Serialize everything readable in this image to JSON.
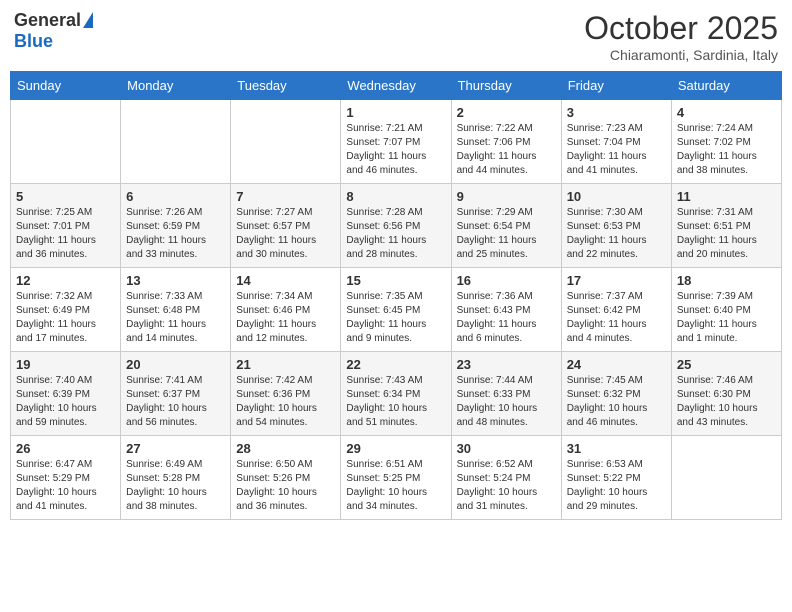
{
  "header": {
    "logo_general": "General",
    "logo_blue": "Blue",
    "month_title": "October 2025",
    "subtitle": "Chiaramonti, Sardinia, Italy"
  },
  "weekdays": [
    "Sunday",
    "Monday",
    "Tuesday",
    "Wednesday",
    "Thursday",
    "Friday",
    "Saturday"
  ],
  "weeks": [
    [
      {
        "day": "",
        "info": ""
      },
      {
        "day": "",
        "info": ""
      },
      {
        "day": "",
        "info": ""
      },
      {
        "day": "1",
        "info": "Sunrise: 7:21 AM\nSunset: 7:07 PM\nDaylight: 11 hours and 46 minutes."
      },
      {
        "day": "2",
        "info": "Sunrise: 7:22 AM\nSunset: 7:06 PM\nDaylight: 11 hours and 44 minutes."
      },
      {
        "day": "3",
        "info": "Sunrise: 7:23 AM\nSunset: 7:04 PM\nDaylight: 11 hours and 41 minutes."
      },
      {
        "day": "4",
        "info": "Sunrise: 7:24 AM\nSunset: 7:02 PM\nDaylight: 11 hours and 38 minutes."
      }
    ],
    [
      {
        "day": "5",
        "info": "Sunrise: 7:25 AM\nSunset: 7:01 PM\nDaylight: 11 hours and 36 minutes."
      },
      {
        "day": "6",
        "info": "Sunrise: 7:26 AM\nSunset: 6:59 PM\nDaylight: 11 hours and 33 minutes."
      },
      {
        "day": "7",
        "info": "Sunrise: 7:27 AM\nSunset: 6:57 PM\nDaylight: 11 hours and 30 minutes."
      },
      {
        "day": "8",
        "info": "Sunrise: 7:28 AM\nSunset: 6:56 PM\nDaylight: 11 hours and 28 minutes."
      },
      {
        "day": "9",
        "info": "Sunrise: 7:29 AM\nSunset: 6:54 PM\nDaylight: 11 hours and 25 minutes."
      },
      {
        "day": "10",
        "info": "Sunrise: 7:30 AM\nSunset: 6:53 PM\nDaylight: 11 hours and 22 minutes."
      },
      {
        "day": "11",
        "info": "Sunrise: 7:31 AM\nSunset: 6:51 PM\nDaylight: 11 hours and 20 minutes."
      }
    ],
    [
      {
        "day": "12",
        "info": "Sunrise: 7:32 AM\nSunset: 6:49 PM\nDaylight: 11 hours and 17 minutes."
      },
      {
        "day": "13",
        "info": "Sunrise: 7:33 AM\nSunset: 6:48 PM\nDaylight: 11 hours and 14 minutes."
      },
      {
        "day": "14",
        "info": "Sunrise: 7:34 AM\nSunset: 6:46 PM\nDaylight: 11 hours and 12 minutes."
      },
      {
        "day": "15",
        "info": "Sunrise: 7:35 AM\nSunset: 6:45 PM\nDaylight: 11 hours and 9 minutes."
      },
      {
        "day": "16",
        "info": "Sunrise: 7:36 AM\nSunset: 6:43 PM\nDaylight: 11 hours and 6 minutes."
      },
      {
        "day": "17",
        "info": "Sunrise: 7:37 AM\nSunset: 6:42 PM\nDaylight: 11 hours and 4 minutes."
      },
      {
        "day": "18",
        "info": "Sunrise: 7:39 AM\nSunset: 6:40 PM\nDaylight: 11 hours and 1 minute."
      }
    ],
    [
      {
        "day": "19",
        "info": "Sunrise: 7:40 AM\nSunset: 6:39 PM\nDaylight: 10 hours and 59 minutes."
      },
      {
        "day": "20",
        "info": "Sunrise: 7:41 AM\nSunset: 6:37 PM\nDaylight: 10 hours and 56 minutes."
      },
      {
        "day": "21",
        "info": "Sunrise: 7:42 AM\nSunset: 6:36 PM\nDaylight: 10 hours and 54 minutes."
      },
      {
        "day": "22",
        "info": "Sunrise: 7:43 AM\nSunset: 6:34 PM\nDaylight: 10 hours and 51 minutes."
      },
      {
        "day": "23",
        "info": "Sunrise: 7:44 AM\nSunset: 6:33 PM\nDaylight: 10 hours and 48 minutes."
      },
      {
        "day": "24",
        "info": "Sunrise: 7:45 AM\nSunset: 6:32 PM\nDaylight: 10 hours and 46 minutes."
      },
      {
        "day": "25",
        "info": "Sunrise: 7:46 AM\nSunset: 6:30 PM\nDaylight: 10 hours and 43 minutes."
      }
    ],
    [
      {
        "day": "26",
        "info": "Sunrise: 6:47 AM\nSunset: 5:29 PM\nDaylight: 10 hours and 41 minutes."
      },
      {
        "day": "27",
        "info": "Sunrise: 6:49 AM\nSunset: 5:28 PM\nDaylight: 10 hours and 38 minutes."
      },
      {
        "day": "28",
        "info": "Sunrise: 6:50 AM\nSunset: 5:26 PM\nDaylight: 10 hours and 36 minutes."
      },
      {
        "day": "29",
        "info": "Sunrise: 6:51 AM\nSunset: 5:25 PM\nDaylight: 10 hours and 34 minutes."
      },
      {
        "day": "30",
        "info": "Sunrise: 6:52 AM\nSunset: 5:24 PM\nDaylight: 10 hours and 31 minutes."
      },
      {
        "day": "31",
        "info": "Sunrise: 6:53 AM\nSunset: 5:22 PM\nDaylight: 10 hours and 29 minutes."
      },
      {
        "day": "",
        "info": ""
      }
    ]
  ]
}
